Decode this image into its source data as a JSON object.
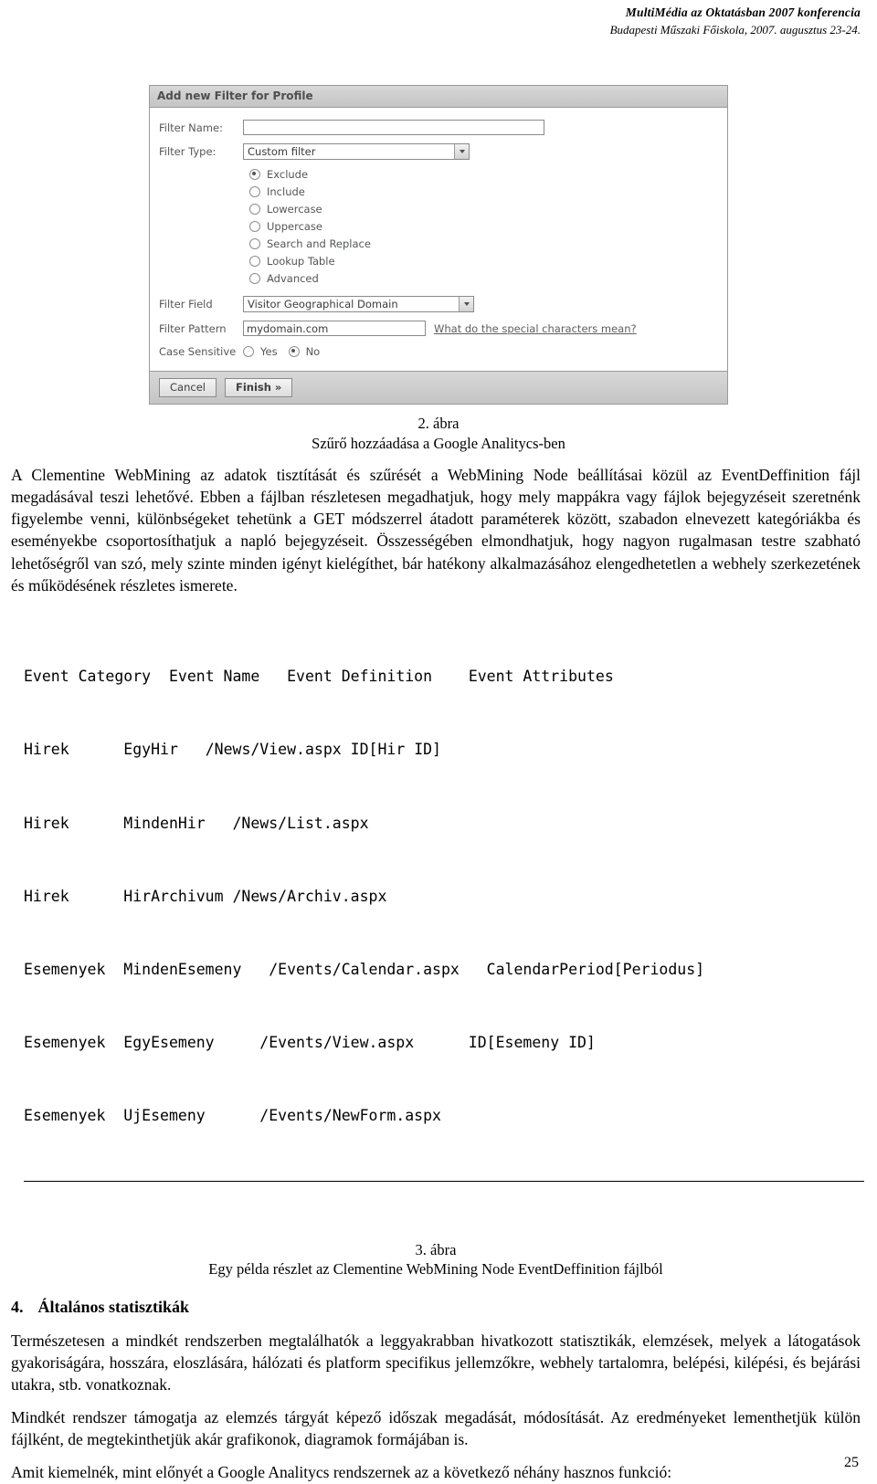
{
  "header": {
    "line1": "MultiMédia az Oktatásban 2007 konferencia",
    "line2": "Budapesti Műszaki Főiskola, 2007. augusztus 23-24."
  },
  "figure2": {
    "titlebar": "Add new Filter for Profile",
    "fields": {
      "filter_name_label": "Filter Name:",
      "filter_name_value": "",
      "filter_type_label": "Filter Type:",
      "filter_type_value": "Custom filter",
      "filter_field_label": "Filter Field",
      "filter_field_value": "Visitor Geographical Domain",
      "filter_pattern_label": "Filter Pattern",
      "filter_pattern_value": "mydomain.com",
      "special_chars_link": "What do the special characters mean?",
      "case_sensitive_label": "Case Sensitive",
      "case_yes": "Yes",
      "case_no": "No"
    },
    "radio_options": [
      "Exclude",
      "Include",
      "Lowercase",
      "Uppercase",
      "Search and Replace",
      "Lookup Table",
      "Advanced"
    ],
    "selected_radio": 0,
    "case_selected": "No",
    "buttons": {
      "cancel": "Cancel",
      "finish": "Finish »"
    },
    "caption_num": "2. ábra",
    "caption_text": "Szűrő hozzáadása a Google Analitycs-ben"
  },
  "paragraphs": {
    "p1": "A Clementine WebMining az adatok tisztítását és szűrését a WebMining Node beállításai közül az EventDeffinition fájl megadásával teszi lehetővé. Ebben a fájlban részletesen megadhatjuk, hogy mely mappákra vagy fájlok bejegyzéseit szeretnénk figyelembe venni, különbségeket tehetünk a GET módszerrel átadott paraméterek között, szabadon elnevezett kategóriákba és eseményekbe csoportosíthatjuk a napló bejegyzéseit. Összességében elmondhatjuk, hogy nagyon rugalmasan testre szabható lehetőségről van szó, mely szinte minden igényt kielégíthet, bár hatékony alkalmazásához elengedhetetlen a webhely szerkezetének és működésének részletes ismerete.",
    "p2": "Természetesen a mindkét rendszerben megtalálhatók a leggyakrabban hivatkozott statisztikák, elemzések, melyek a látogatások gyakoriságára, hosszára, eloszlására, hálózati és platform specifikus jellemzőkre, webhely tartalomra, belépési, kilépési, és bejárási utakra, stb. vonatkoznak.",
    "p3": "Mindkét rendszer támogatja az elemzés tárgyát képező időszak megadását, módosítását. Az eredményeket lementhetjük külön fájlként, de megtekinthetjük akár grafikonok, diagramok formájában is.",
    "p4": "Amit kiemelnék, mint előnyét a Google Analitycs rendszernek az a következő néhány hasznos funkció:"
  },
  "figure3": {
    "header_row": [
      "Event Category",
      "Event Name",
      "Event Definition",
      "Event Attributes"
    ],
    "rows": [
      [
        "Hirek",
        "EgyHir",
        "/News/View.aspx",
        "ID[Hir ID]"
      ],
      [
        "Hirek",
        "MindenHir",
        "/News/List.aspx",
        ""
      ],
      [
        "Hirek",
        "HirArchivum",
        "/News/Archiv.aspx",
        ""
      ],
      [
        "Esemenyek",
        "MindenEsemeny",
        "/Events/Calendar.aspx",
        "CalendarPeriod[Periodus]"
      ],
      [
        "Esemenyek",
        "EgyEsemeny",
        "/Events/View.aspx",
        "ID[Esemeny ID]"
      ],
      [
        "Esemenyek",
        "UjEsemeny",
        "/Events/NewForm.aspx",
        ""
      ]
    ],
    "caption_num": "3. ábra",
    "caption_text": "Egy példa részlet az Clementine WebMining Node EventDeffinition fájlból"
  },
  "section": {
    "index": "4.",
    "title": "Általános statisztikák"
  },
  "page_number": "25"
}
